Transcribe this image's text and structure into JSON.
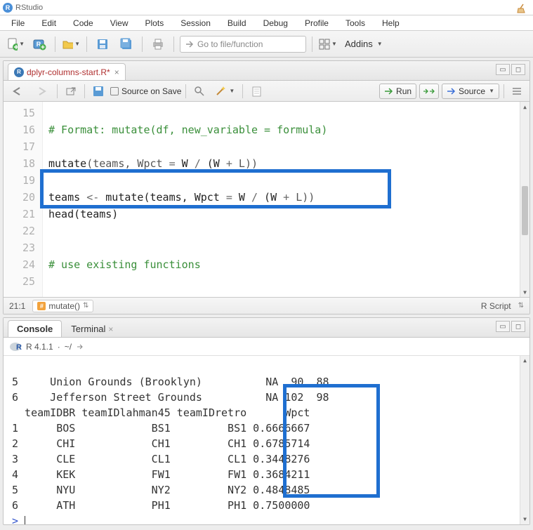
{
  "app": {
    "title": "RStudio"
  },
  "menubar": [
    "File",
    "Edit",
    "Code",
    "View",
    "Plots",
    "Session",
    "Build",
    "Debug",
    "Profile",
    "Tools",
    "Help"
  ],
  "toolbar": {
    "gotofile_placeholder": "Go to file/function",
    "addins_label": "Addins"
  },
  "editor": {
    "filename": "dplyr-columns-start.R*",
    "source_on_save": "Source on Save",
    "run_label": "Run",
    "source_label": "Source",
    "cursor_pos": "21:1",
    "section_fn": "mutate()",
    "mode_label": "R Script",
    "gutter_lines": [
      "15",
      "16",
      "17",
      "18",
      "19",
      "20",
      "21",
      "22",
      "23",
      "24",
      "25"
    ],
    "code_lines": {
      "l15": "# Format: mutate(df, new_variable = formula)",
      "l17_a": "mutate",
      "l17_b": "(teams, Wpct ",
      "l17_c": "=",
      "l17_d": " W ",
      "l17_e": "/",
      "l17_f": " (W ",
      "l17_g": "+",
      "l17_h": " L))",
      "l19_a": "teams ",
      "l19_b": "<-",
      "l19_c": " mutate(teams, Wpct ",
      "l19_d": "=",
      "l19_e": " W ",
      "l19_f": "/",
      "l19_g": " (W ",
      "l19_h": "+",
      "l19_i": " L))",
      "l20": "head(teams)",
      "l23": "# use existing functions"
    }
  },
  "console": {
    "tab_console": "Console",
    "tab_terminal": "Terminal",
    "r_version": "R 4.1.1",
    "wd": "~/",
    "lines": [
      "5     Union Grounds (Brooklyn)          NA  90  88",
      "6     Jefferson Street Grounds          NA 102  98",
      "  teamIDBR teamIDlahman45 teamIDretro      Wpct",
      "1      BOS            BS1         BS1 0.6666667",
      "2      CHI            CH1         CH1 0.6785714",
      "3      CLE            CL1         CL1 0.3448276",
      "4      KEK            FW1         FW1 0.3684211",
      "5      NYU            NY2         NY2 0.4848485",
      "6      ATH            PH1         PH1 0.7500000"
    ],
    "prompt": "> "
  },
  "chart_data": {
    "type": "table",
    "title": "head(teams) after mutate Wpct = W/(W+L)",
    "columns": [
      "teamIDBR",
      "teamIDlahman45",
      "teamIDretro",
      "Wpct"
    ],
    "rows": [
      [
        "BOS",
        "BS1",
        "BS1",
        0.6666667
      ],
      [
        "CHI",
        "CH1",
        "CH1",
        0.6785714
      ],
      [
        "CLE",
        "CL1",
        "CL1",
        0.3448276
      ],
      [
        "KEK",
        "FW1",
        "FW1",
        0.3684211
      ],
      [
        "NYU",
        "NY2",
        "NY2",
        0.4848485
      ],
      [
        "ATH",
        "PH1",
        "PH1",
        0.75
      ]
    ]
  }
}
